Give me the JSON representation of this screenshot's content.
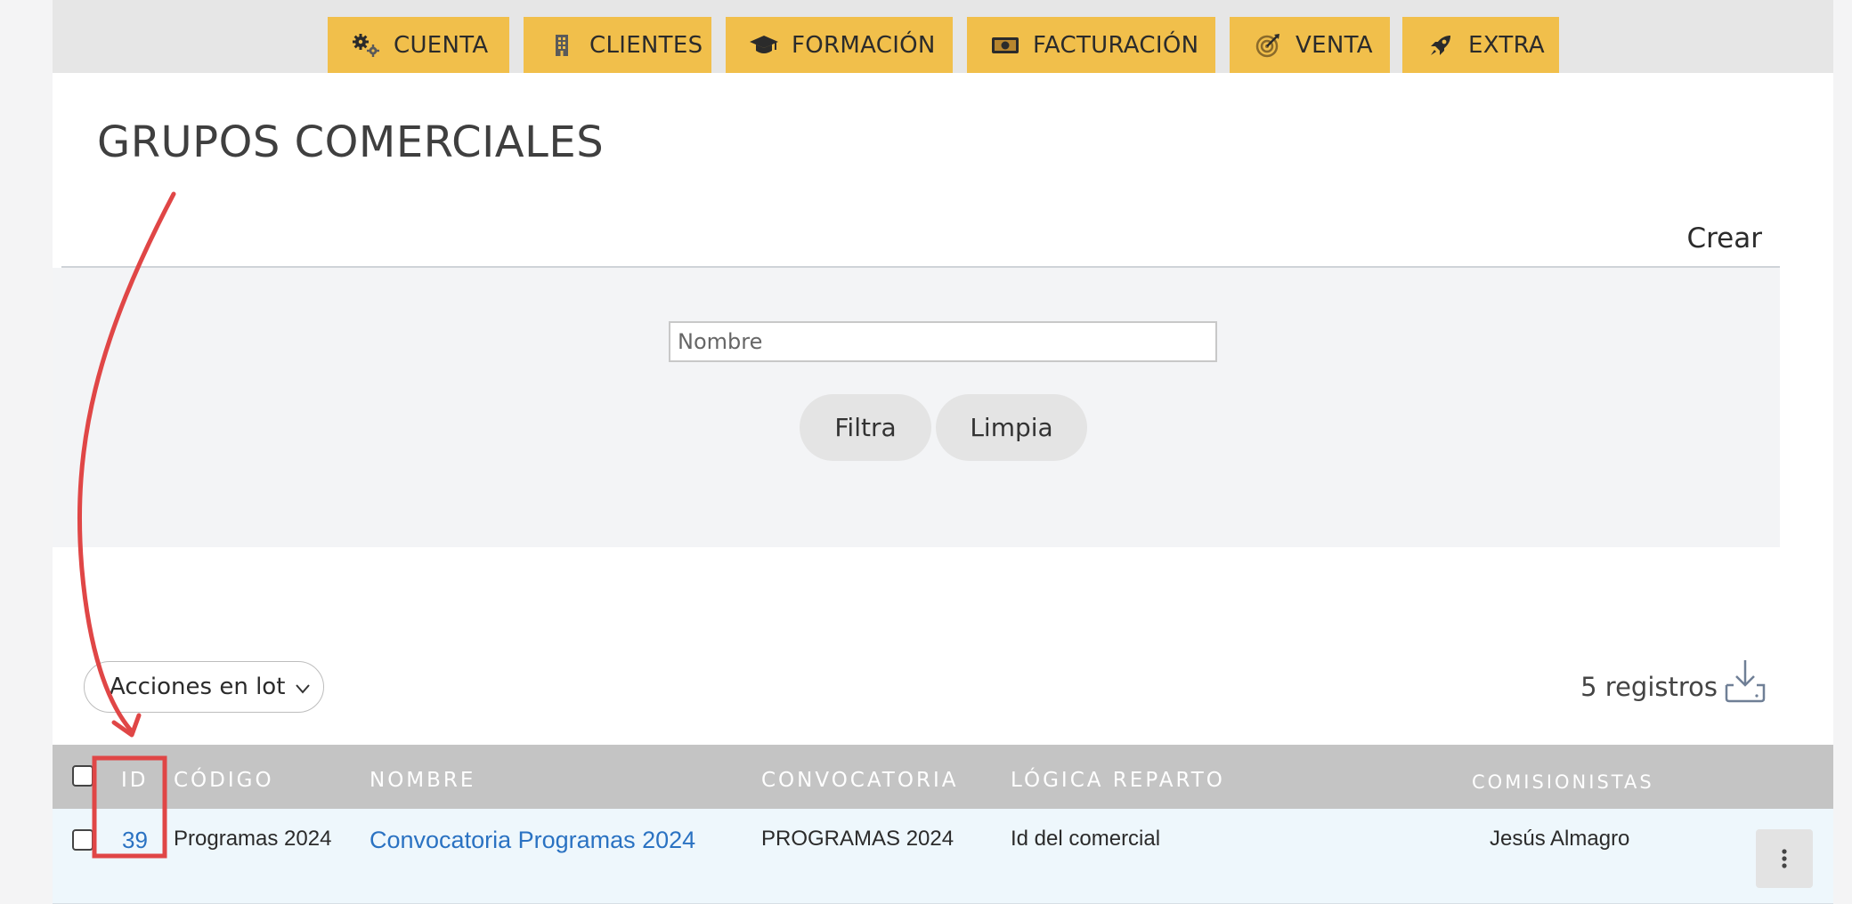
{
  "nav": {
    "items": [
      {
        "label": "CUENTA",
        "icon": "gears-icon"
      },
      {
        "label": "CLIENTES",
        "icon": "building-icon"
      },
      {
        "label": "FORMACIÓN",
        "icon": "graduation-cap-icon"
      },
      {
        "label": "FACTURACIÓN",
        "icon": "money-bill-icon"
      },
      {
        "label": "VENTA",
        "icon": "bullseye-icon"
      },
      {
        "label": "EXTRA",
        "icon": "rocket-icon"
      }
    ],
    "color": "#f1bf4b"
  },
  "page": {
    "title": "GRUPOS COMERCIALES",
    "create_label": "Crear"
  },
  "filters": {
    "name_placeholder": "Nombre",
    "filter_button": "Filtra",
    "clear_button": "Limpia"
  },
  "toolbar": {
    "bulk_actions_label": "Acciones en lot",
    "records_label": "5 registros"
  },
  "table": {
    "columns": [
      "ID",
      "CÓDIGO",
      "NOMBRE",
      "CONVOCATORIA",
      "LÓGICA REPARTO",
      "COMISIONISTAS"
    ],
    "rows": [
      {
        "id": "39",
        "codigo": "Programas 2024",
        "nombre": "Convocatoria Programas 2024",
        "convocatoria": "PROGRAMAS 2024",
        "logica": "Id del comercial",
        "comisionistas": "Jesús Almagro"
      }
    ]
  },
  "annotation": {
    "color": "#e04646"
  }
}
